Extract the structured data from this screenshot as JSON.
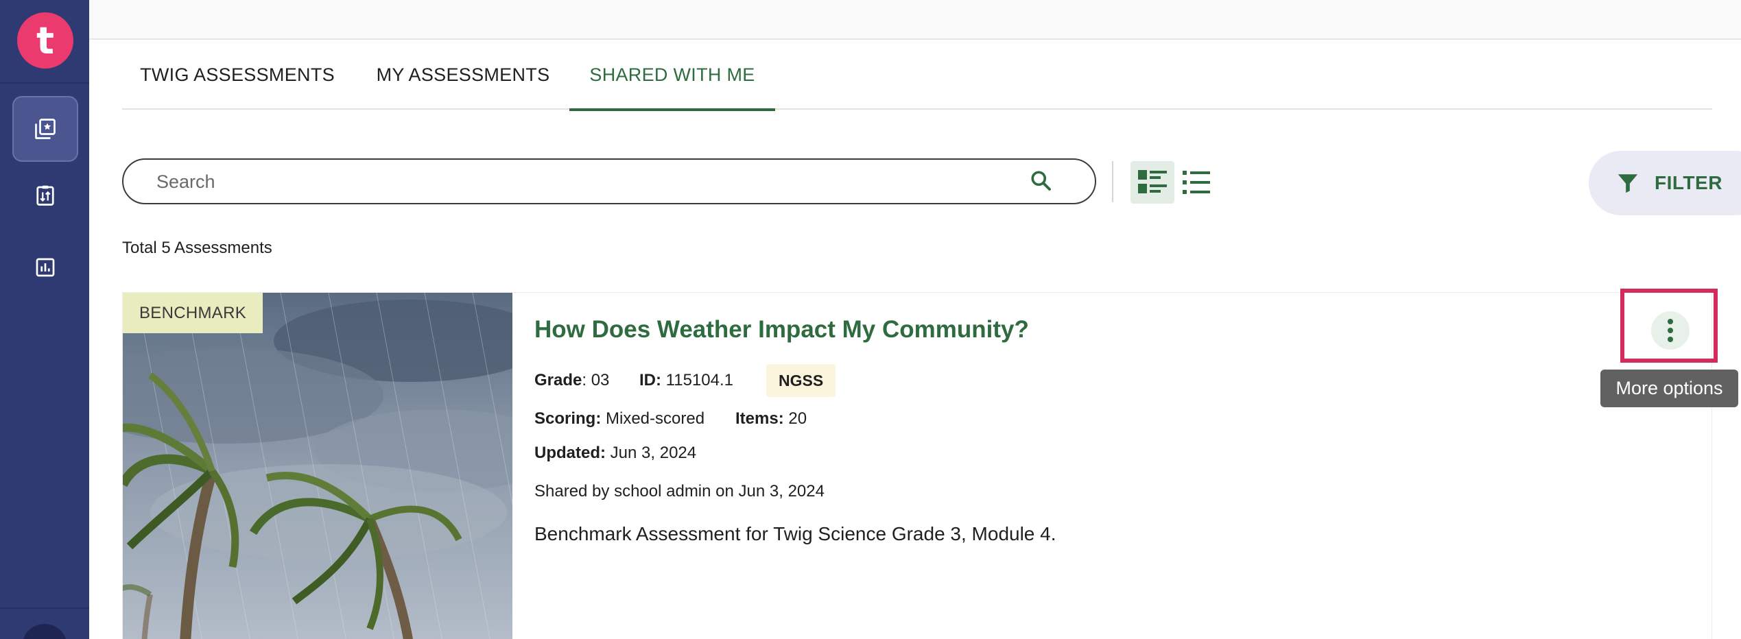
{
  "app": {
    "logo_letter": "t"
  },
  "sidebar": {
    "items": [
      {
        "icon": "library-star-icon",
        "active": true
      },
      {
        "icon": "clipboard-sort-icon",
        "active": false
      },
      {
        "icon": "bar-chart-icon",
        "active": false
      }
    ]
  },
  "tabs": [
    {
      "label": "TWIG ASSESSMENTS",
      "active": false
    },
    {
      "label": "MY ASSESSMENTS",
      "active": false
    },
    {
      "label": "SHARED WITH ME",
      "active": true
    }
  ],
  "search": {
    "placeholder": "Search",
    "value": ""
  },
  "toolbar": {
    "filter_label": "FILTER"
  },
  "summary": {
    "total_text": "Total 5 Assessments"
  },
  "assessment": {
    "badge": "BENCHMARK",
    "title": "How Does Weather Impact My Community?",
    "grade_label": "Grade",
    "grade_value": ": 03",
    "id_label": "ID:",
    "id_value": " 115104.1",
    "standard": "NGSS",
    "scoring_label": "Scoring:",
    "scoring_value": " Mixed-scored",
    "items_label": "Items:",
    "items_value": " 20",
    "updated_label": "Updated:",
    "updated_value": " Jun 3, 2024",
    "shared_text": "Shared by school admin on Jun 3, 2024",
    "description": "Benchmark Assessment for Twig Science Grade 3, Module 4."
  },
  "more_menu": {
    "tooltip": "More options"
  },
  "colors": {
    "sidebar": "#2f3a73",
    "brand_pink": "#ea3a6e",
    "accent_green": "#2e6b3f",
    "highlight": "#d42a5c"
  }
}
